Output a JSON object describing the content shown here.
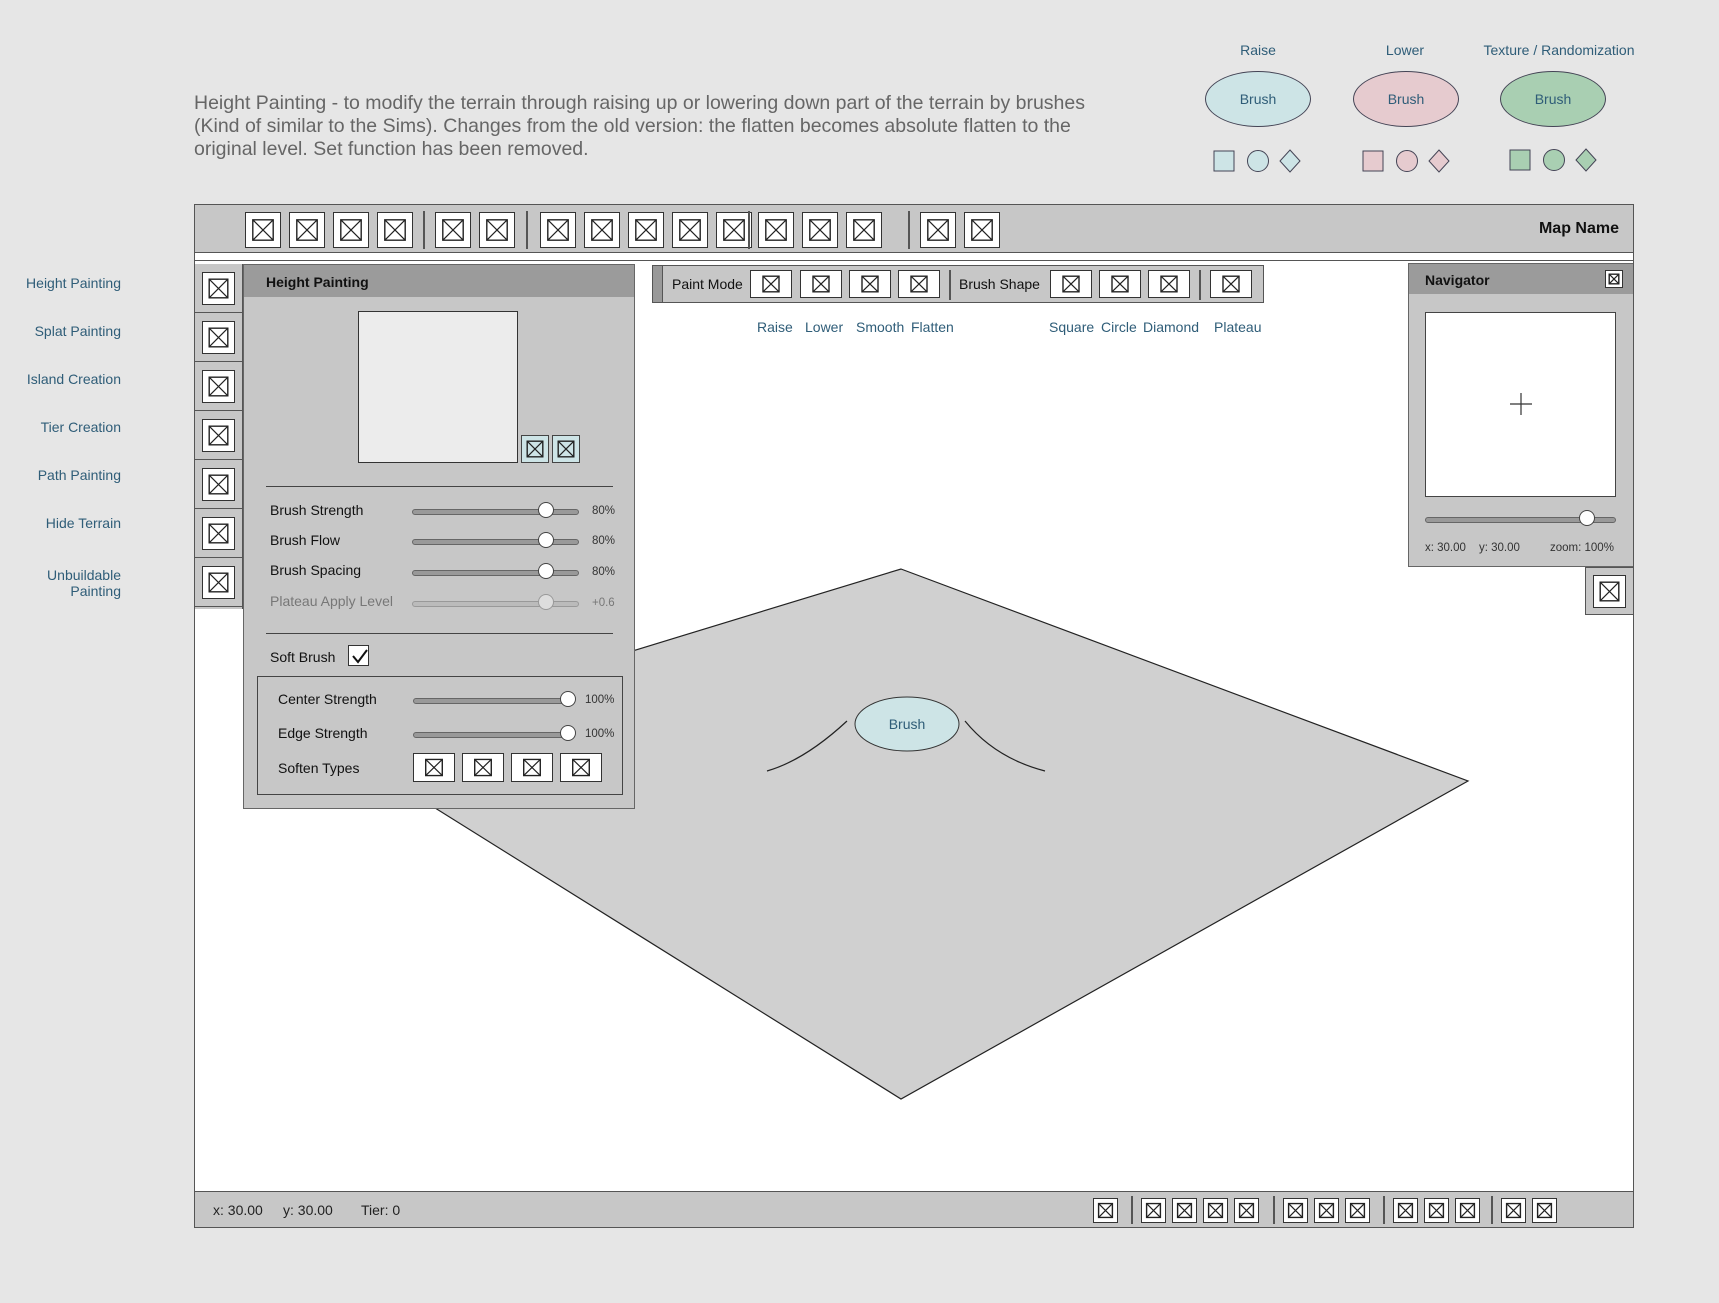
{
  "description": "Height Painting - to modify the terrain through raising up or lowering down part of the terrain by brushes (Kind of similar to the Sims). Changes from the old version: the flatten becomes absolute flatten to the original level. Set function has been removed.",
  "legend": [
    {
      "title": "Raise",
      "brush": "Brush",
      "color": "#cde4e6"
    },
    {
      "title": "Lower",
      "brush": "Brush",
      "color": "#e6cbcf"
    },
    {
      "title": "Texture / Randomization",
      "brush": "Brush",
      "color": "#a9cfb2"
    }
  ],
  "side_labels": [
    "Height Painting",
    "Splat Painting",
    "Island Creation",
    "Tier Creation",
    "Path Painting",
    "Hide Terrain",
    "Unbuildable Painting"
  ],
  "toolbar": {
    "map_name": "Map Name"
  },
  "height_panel": {
    "title": "Height Painting",
    "sliders": [
      {
        "label": "Brush Strength",
        "value": "80%",
        "level": 0.8
      },
      {
        "label": "Brush Flow",
        "value": "80%",
        "level": 0.8
      },
      {
        "label": "Brush Spacing",
        "value": "80%",
        "level": 0.8
      },
      {
        "label": "Plateau Apply Level",
        "value": "+0.6",
        "level": 0.8
      }
    ],
    "soft_brush_label": "Soft Brush",
    "soft_brush_checked": true,
    "center_strength": {
      "label": "Center Strength",
      "value": "100%",
      "level": 1.0
    },
    "edge_strength": {
      "label": "Edge Strength",
      "value": "100%",
      "level": 1.0
    },
    "soften_types_label": "Soften Types"
  },
  "paint_bar": {
    "paint_mode_label": "Paint Mode",
    "brush_shape_label": "Brush Shape",
    "mode_labels": [
      "Raise",
      "Lower",
      "Smooth",
      "Flatten"
    ],
    "shape_labels": [
      "Square",
      "Circle",
      "Diamond"
    ],
    "plateau_label": "Plateau"
  },
  "navigator": {
    "title": "Navigator",
    "x": "x:  30.00",
    "y": "y:  30.00",
    "zoom": "zoom: 100%",
    "zoom_level": 0.85
  },
  "canvas": {
    "brush_label": "Brush",
    "brush_color": "#cde4e6",
    "terrain_color": "#d0d0d0"
  },
  "status": {
    "x": "x: 30.00",
    "y": "y: 30.00",
    "tier": "Tier: 0"
  }
}
